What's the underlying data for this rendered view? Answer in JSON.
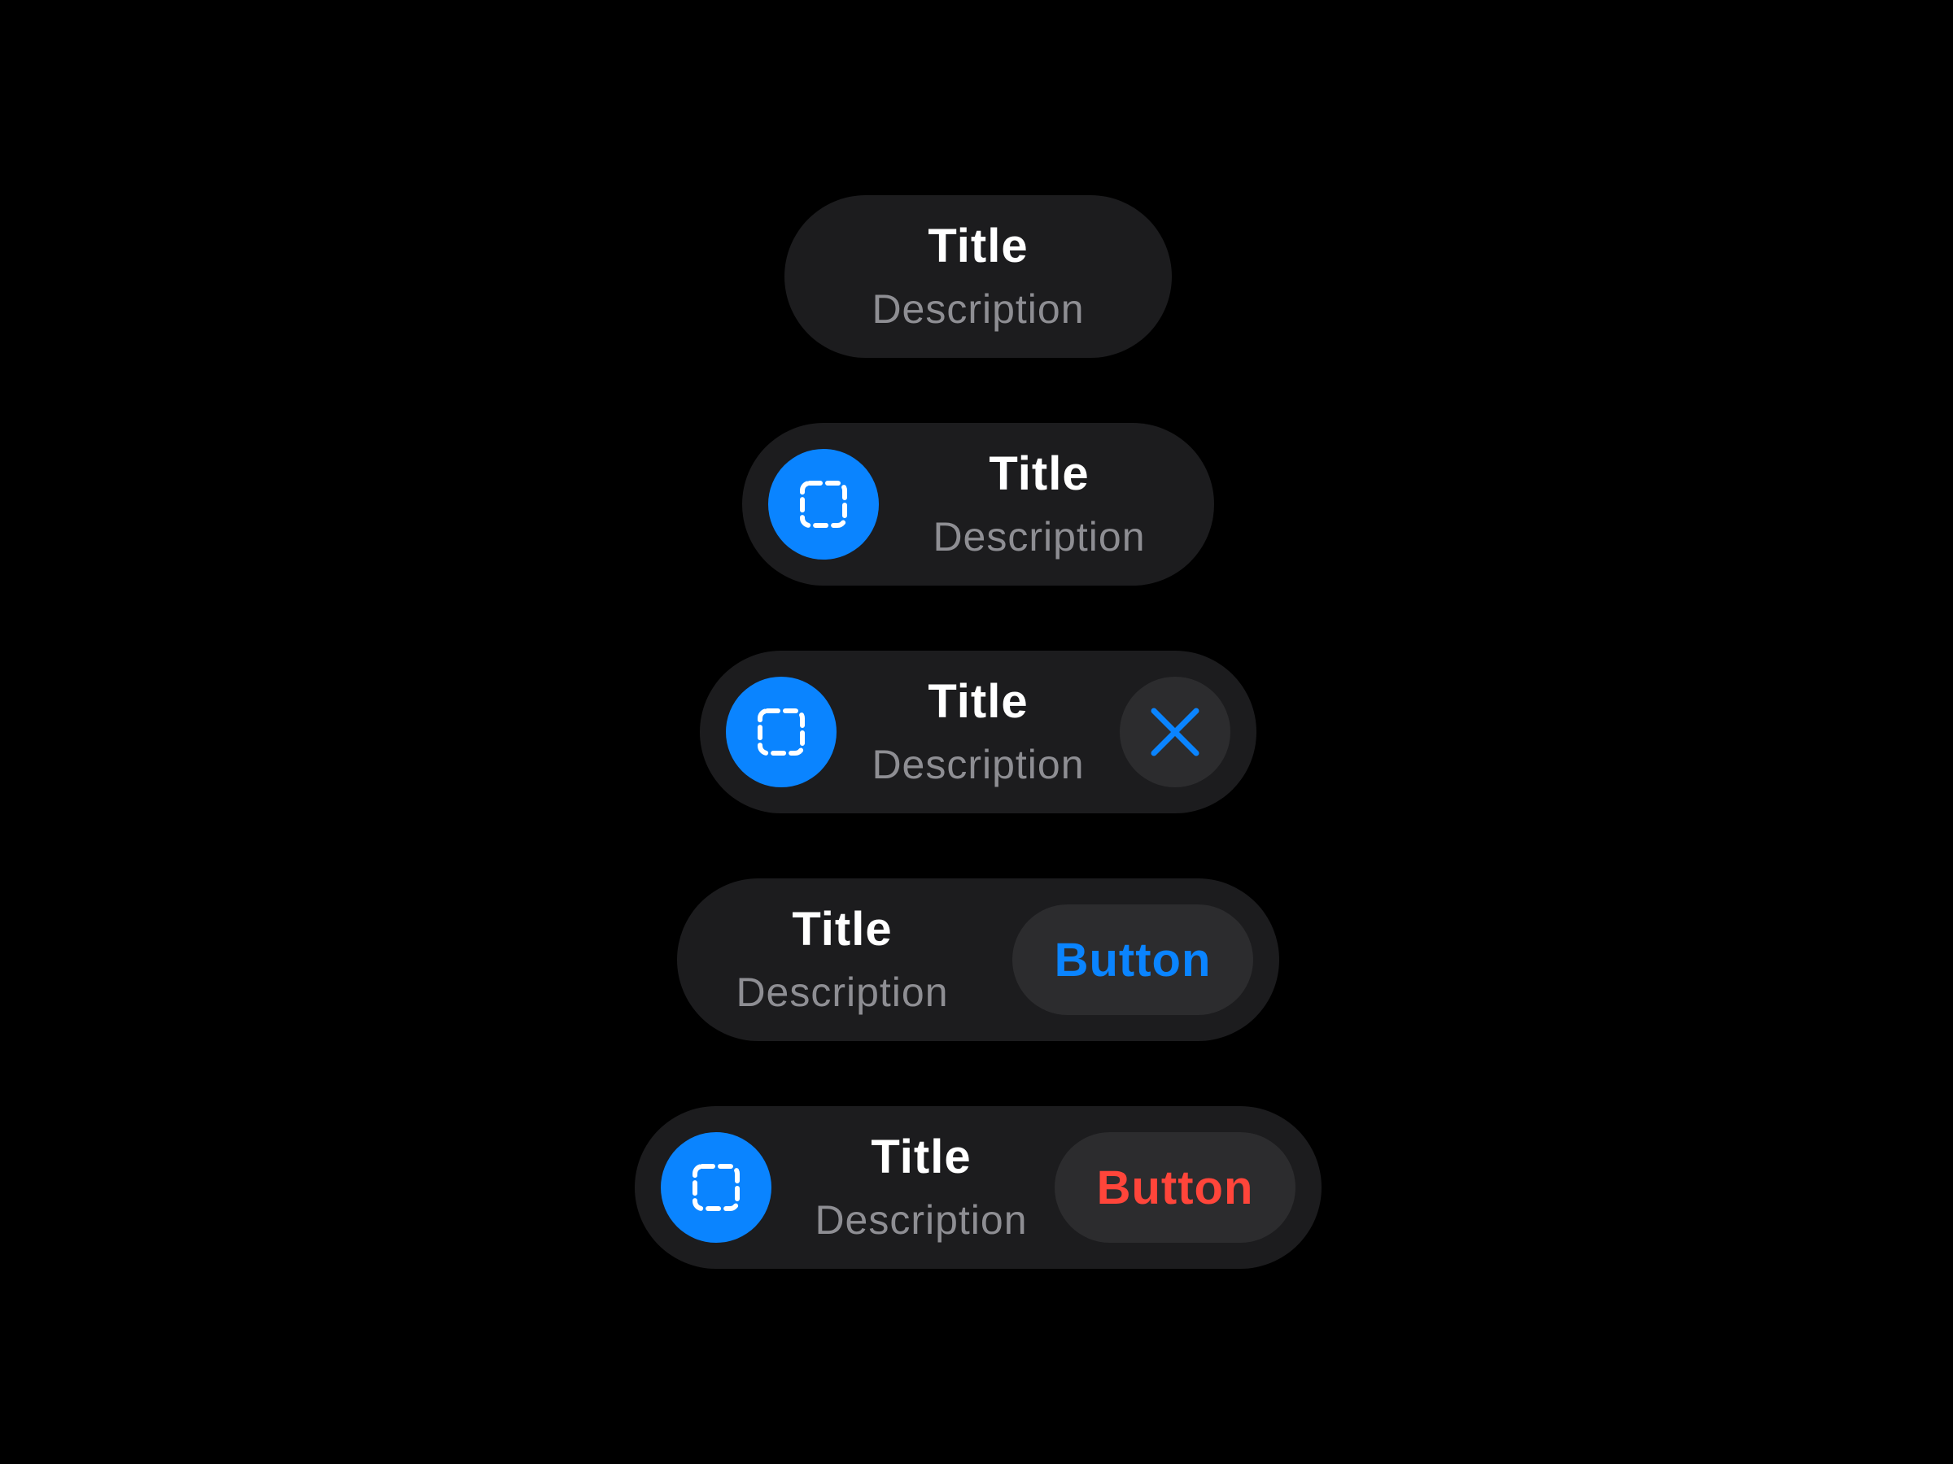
{
  "colors": {
    "background": "#000000",
    "pill": "#1c1c1e",
    "secondary_button": "#2c2c2e",
    "accent_blue": "#0a84ff",
    "destructive_red": "#ff453a",
    "title": "#ffffff",
    "description": "#8e8e93"
  },
  "toasts": [
    {
      "title": "Title",
      "description": "Description"
    },
    {
      "title": "Title",
      "description": "Description",
      "leading_icon": "dashed-square-icon"
    },
    {
      "title": "Title",
      "description": "Description",
      "leading_icon": "dashed-square-icon",
      "trailing_icon": "close-icon"
    },
    {
      "title": "Title",
      "description": "Description",
      "button_label": "Button",
      "button_style": "blue"
    },
    {
      "title": "Title",
      "description": "Description",
      "leading_icon": "dashed-square-icon",
      "button_label": "Button",
      "button_style": "red"
    }
  ]
}
